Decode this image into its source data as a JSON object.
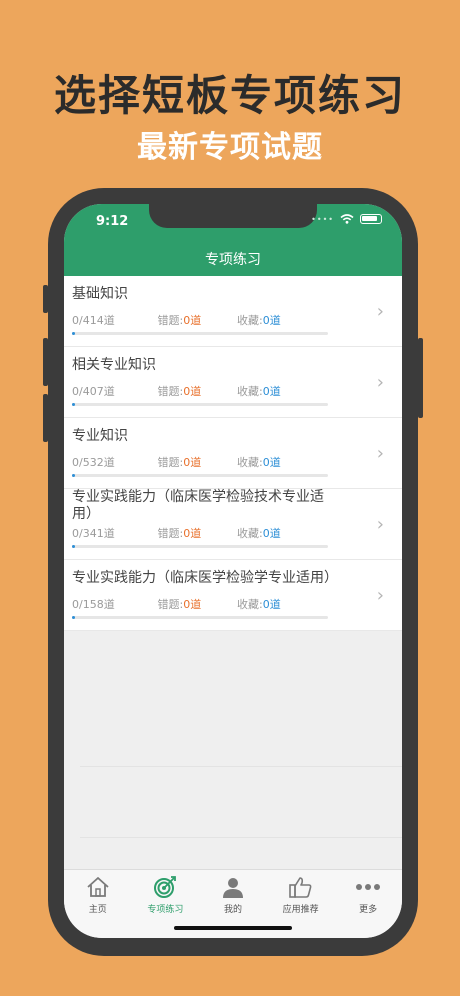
{
  "promo": {
    "headline": "选择短板专项练习",
    "subheadline": "最新专项试题"
  },
  "status_bar": {
    "time": "9:12"
  },
  "app_bar": {
    "title": "专项练习"
  },
  "sections": [
    {
      "title": "基础知识",
      "count": "0/414道",
      "wrong_label": "错题:",
      "wrong_value": "0道",
      "fav_label": "收藏:",
      "fav_value": "0道",
      "progress": 0.01
    },
    {
      "title": "相关专业知识",
      "count": "0/407道",
      "wrong_label": "错题:",
      "wrong_value": "0道",
      "fav_label": "收藏:",
      "fav_value": "0道",
      "progress": 0.01
    },
    {
      "title": "专业知识",
      "count": "0/532道",
      "wrong_label": "错题:",
      "wrong_value": "0道",
      "fav_label": "收藏:",
      "fav_value": "0道",
      "progress": 0.01
    },
    {
      "title": "专业实践能力（临床医学检验技术专业适用）",
      "count": "0/341道",
      "wrong_label": "错题:",
      "wrong_value": "0道",
      "fav_label": "收藏:",
      "fav_value": "0道",
      "progress": 0.01
    },
    {
      "title": "专业实践能力（临床医学检验学专业适用）",
      "count": "0/158道",
      "wrong_label": "错题:",
      "wrong_value": "0道",
      "fav_label": "收藏:",
      "fav_value": "0道",
      "progress": 0.01
    }
  ],
  "tabs": [
    {
      "label": "主页",
      "icon": "home-icon",
      "active": false
    },
    {
      "label": "专项练习",
      "icon": "target-icon",
      "active": true
    },
    {
      "label": "我的",
      "icon": "user-icon",
      "active": false
    },
    {
      "label": "应用推荐",
      "icon": "thumbs-up-icon",
      "active": false
    },
    {
      "label": "更多",
      "icon": "more-icon",
      "active": false
    }
  ],
  "colors": {
    "background": "#EDA65C",
    "app_green": "#2E9E6B",
    "wrong": "#E8712D",
    "favorite": "#2E8FD6"
  }
}
